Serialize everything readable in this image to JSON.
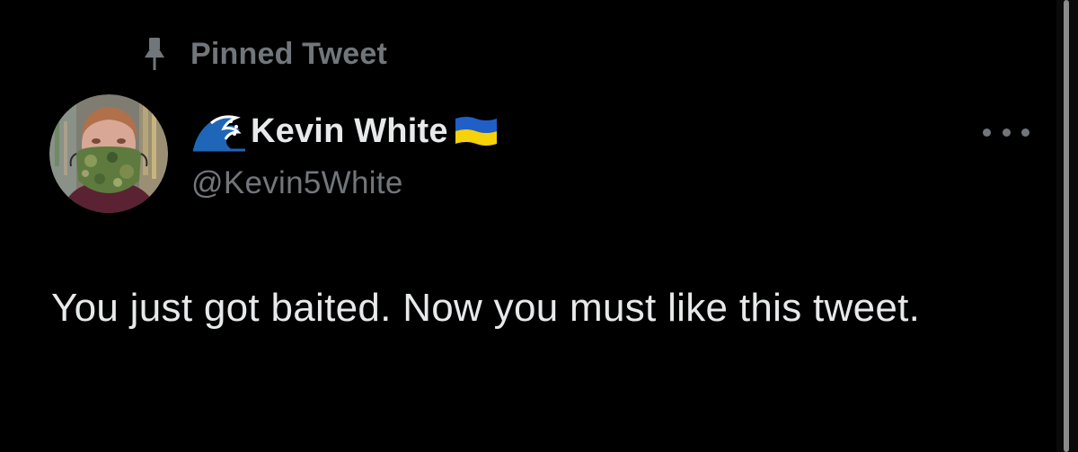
{
  "pinned": {
    "label": "Pinned Tweet",
    "icon": "pin-icon"
  },
  "author": {
    "display_name": "Kevin White",
    "handle": "@Kevin5White",
    "name_prefix_icon": "wave-emoji-icon",
    "name_suffix_icon": "ukraine-flag-icon"
  },
  "tweet": {
    "text": "You just got baited. Now you must like this tweet."
  },
  "more_menu": {
    "icon": "more-options-icon"
  },
  "colors": {
    "background": "#000000",
    "primary_text": "#e7e9ea",
    "secondary_text": "#71767b",
    "flag_blue": "#1f5fc7",
    "flag_yellow": "#f5d20a"
  }
}
